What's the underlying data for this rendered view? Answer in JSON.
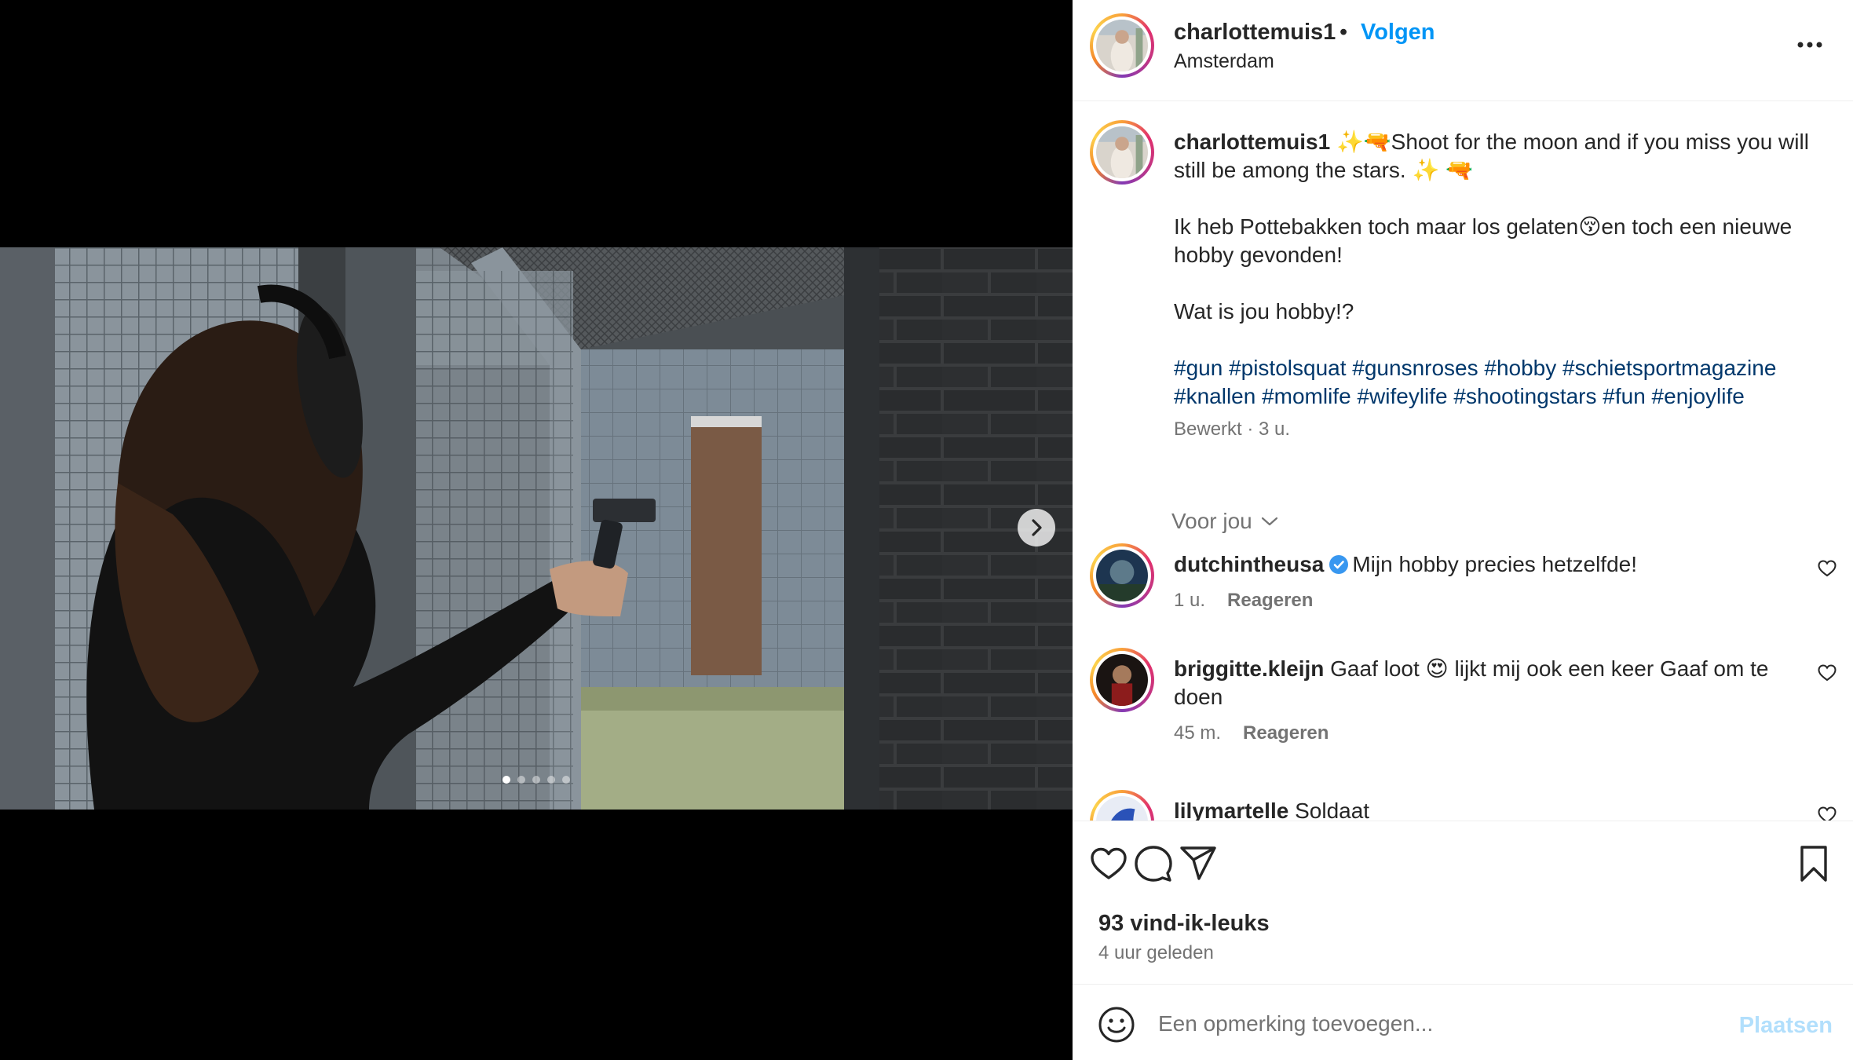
{
  "post": {
    "username": "charlottemuis1",
    "separator": "•",
    "follow_label": "Volgen",
    "location": "Amsterdam",
    "carousel": {
      "slide_count": 5,
      "active_index": 0
    }
  },
  "caption": {
    "username": "charlottemuis1",
    "line1": "✨🔫Shoot for the moon and if you miss you will still be among the stars. ✨ 🔫",
    "line2": "Ik heb Pottebakken toch maar los gelaten😚en toch een nieuwe hobby gevonden!",
    "line3": "Wat is jou hobby!?",
    "hashtags": "#gun #pistolsquat #gunsnroses #hobby #schietsportmagazine #knallen #momlife #wifeylife #shootingstars #fun #enjoylife",
    "meta": "Bewerkt · 3 u."
  },
  "filter_label": "Voor jou",
  "comments": [
    {
      "username": "dutchintheusa",
      "text": "Mijn hobby precies hetzelfde!",
      "time": "1 u.",
      "reply": "Reageren"
    },
    {
      "username": "briggitte.kleijn",
      "text": "Gaaf loot 😍 lijkt mij ook een keer Gaaf om te doen",
      "time": "45 m.",
      "reply": "Reageren"
    },
    {
      "username": "lilymartelle",
      "text": "Soldaat",
      "time": "",
      "reply": ""
    }
  ],
  "likes": "93 vind-ik-leuks",
  "time_ago": "4 uur geleden",
  "comment_box": {
    "placeholder": "Een opmerking toevoegen...",
    "post_label": "Plaatsen"
  },
  "colors": {
    "link_blue": "#0095f6",
    "hashtag_blue": "#00376b",
    "muted": "#737373",
    "post_disabled": "#b2dffc",
    "verified_blue": "#3897f0"
  },
  "icons": [
    "more-icon",
    "chevron-right-icon",
    "chevron-down-icon",
    "verified-badge-icon",
    "heart-icon",
    "comment-icon",
    "share-icon",
    "bookmark-icon",
    "emoji-icon"
  ]
}
